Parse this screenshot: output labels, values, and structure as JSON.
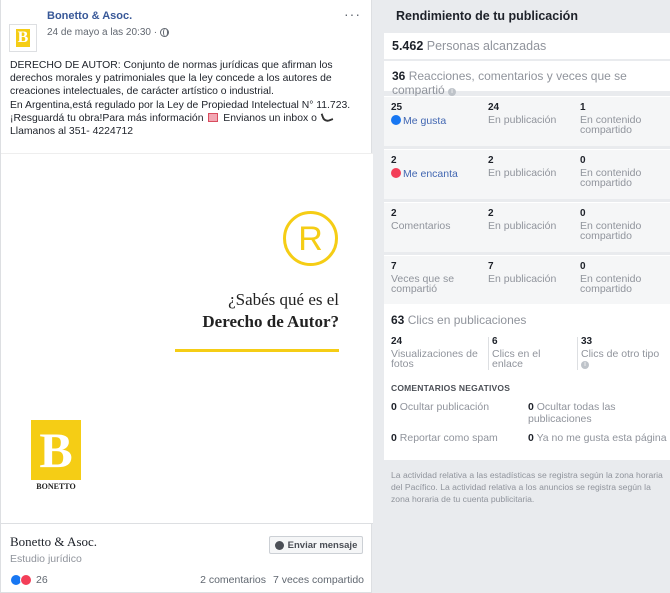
{
  "post": {
    "page_name": "Bonetto & Asoc.",
    "date": "24 de mayo a las 20:30 ·",
    "more": "···",
    "text_lines": [
      "DERECHO DE AUTOR: Conjunto de normas jurídicas que afirman los",
      "derechos morales y patrimoniales que la ley concede a los autores de",
      "creaciones intelectuales, de carácter artístico o industrial.",
      "En Argentina,está regulado por la Ley de Propiedad Intelectual N° 11.723.",
      "¡Resguardá tu obra!Para más información",
      "Envianos un inbox o",
      "Llamanos al 351- 4224712"
    ],
    "logo_letter": "B",
    "image": {
      "reg_symbol": "R",
      "question_line1": "¿Sabés qué es el",
      "question_line2": "Derecho de Autor?",
      "brand_letter": "B",
      "brand_name": "BONETTO"
    },
    "footer": {
      "page_name": "Bonetto & Asoc.",
      "category": "Estudio jurídico",
      "message_button": "Enviar mensaje",
      "reaction_count": "26",
      "comments": "2 comentarios",
      "shares": "7 veces compartido"
    }
  },
  "panel": {
    "title": "Rendimiento de tu publicación",
    "reach_value": "5.462",
    "reach_label": "Personas alcanzadas",
    "engagement_value": "36",
    "engagement_label": "Reacciones, comentarios y veces que se compartió",
    "rows": [
      {
        "total": "25",
        "label": "Me gusta",
        "on_post": "24",
        "on_post_label": "En publicación",
        "on_shared": "1",
        "on_shared_label": "En contenido compartido"
      },
      {
        "total": "2",
        "label": "Me encanta",
        "on_post": "2",
        "on_post_label": "En publicación",
        "on_shared": "0",
        "on_shared_label": "En contenido compartido"
      },
      {
        "total": "2",
        "label": "Comentarios",
        "on_post": "2",
        "on_post_label": "En publicación",
        "on_shared": "0",
        "on_shared_label": "En contenido compartido"
      },
      {
        "total": "7",
        "label": "Veces que se compartió",
        "on_post": "7",
        "on_post_label": "En publicación",
        "on_shared": "0",
        "on_shared_label": "En contenido compartido"
      }
    ],
    "clicks": {
      "value": "63",
      "label": "Clics en publicaciones",
      "photo_views": "24",
      "photo_views_label": "Visualizaciones de fotos",
      "link_clicks": "6",
      "link_clicks_label": "Clics en el enlace",
      "other_clicks": "33",
      "other_clicks_label": "Clics de otro tipo"
    },
    "negative": {
      "heading": "COMENTARIOS NEGATIVOS",
      "hide_post": "0",
      "hide_post_label": "Ocultar publicación",
      "hide_all": "0",
      "hide_all_label": "Ocultar todas las publicaciones",
      "report_spam": "0",
      "report_spam_label": "Reportar como spam",
      "unlike_page": "0",
      "unlike_page_label": "Ya no me gusta esta página"
    },
    "footnote": "La actividad relativa a las estadísticas se registra según la zona horaria del Pacífico. La actividad relativa a los anuncios se registra según la zona horaria de tu cuenta publicitaria."
  }
}
